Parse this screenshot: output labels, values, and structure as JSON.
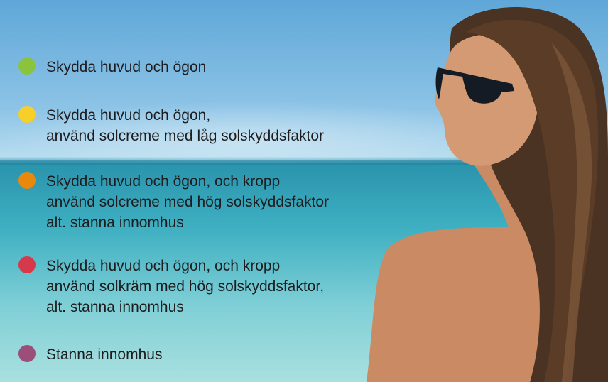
{
  "legend": {
    "items": [
      {
        "color": "#8ac43f",
        "lines": [
          "Skydda huvud och ögon"
        ]
      },
      {
        "color": "#f6cf29",
        "lines": [
          "Skydda huvud och ögon,",
          "använd solcreme med låg solskyddsfaktor"
        ]
      },
      {
        "color": "#e8890d",
        "lines": [
          "Skydda huvud och ögon, och kropp",
          "använd solcreme med hög solskyddsfaktor",
          "alt. stanna innomhus"
        ]
      },
      {
        "color": "#d63a4a",
        "lines": [
          "Skydda huvud och ögon, och kropp",
          "använd solkräm med hög solskyddsfaktor,",
          "alt. stanna innomhus"
        ]
      },
      {
        "color": "#9a4e78",
        "lines": [
          "Stanna innomhus"
        ]
      }
    ]
  }
}
